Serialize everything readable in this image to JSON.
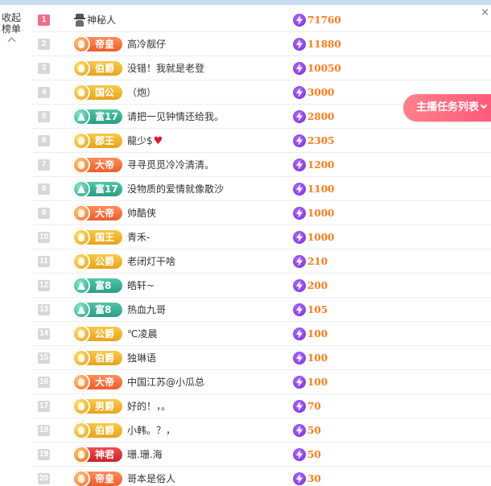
{
  "collapse": {
    "label": "收起榜单"
  },
  "close_glyph": "×",
  "task_button": {
    "label": "主播任务列表"
  },
  "rows": [
    {
      "rank": "1",
      "badge": null,
      "badge_style": "mystery",
      "name": "神秘人",
      "score": "71760"
    },
    {
      "rank": "2",
      "badge": "帝皇",
      "badge_style": "orange",
      "name": "高冷靓仔",
      "score": "11880"
    },
    {
      "rank": "3",
      "badge": "伯爵",
      "badge_style": "gold",
      "name": "没错！我就是老登",
      "score": "10050"
    },
    {
      "rank": "4",
      "badge": "国公",
      "badge_style": "gold",
      "name": "（炮）",
      "score": "3000"
    },
    {
      "rank": "5",
      "badge": "富17",
      "badge_style": "teal",
      "name": "请把一见钟情还给我。",
      "score": "2800"
    },
    {
      "rank": "6",
      "badge": "郡王",
      "badge_style": "gold",
      "name": "龍少$",
      "score": "2305",
      "heart": true
    },
    {
      "rank": "7",
      "badge": "大帝",
      "badge_style": "orange",
      "name": "寻寻觅觅冷冷清清。",
      "score": "1200"
    },
    {
      "rank": "8",
      "badge": "富17",
      "badge_style": "teal",
      "name": "没物质的爱情就像散沙",
      "score": "1100"
    },
    {
      "rank": "9",
      "badge": "大帝",
      "badge_style": "orange",
      "name": "帅酷侠",
      "score": "1000"
    },
    {
      "rank": "10",
      "badge": "国王",
      "badge_style": "gold",
      "name": "青禾-",
      "score": "1000"
    },
    {
      "rank": "11",
      "badge": "公爵",
      "badge_style": "gold",
      "name": "老闭灯干啥",
      "score": "210"
    },
    {
      "rank": "12",
      "badge": "富8",
      "badge_style": "teal",
      "name": "皓轩~",
      "score": "200"
    },
    {
      "rank": "13",
      "badge": "富8",
      "badge_style": "teal",
      "name": "热血九哥",
      "score": "105"
    },
    {
      "rank": "14",
      "badge": "公爵",
      "badge_style": "gold",
      "name": "℃凌晨",
      "score": "100"
    },
    {
      "rank": "15",
      "badge": "伯爵",
      "badge_style": "gold",
      "name": "独琳语",
      "score": "100"
    },
    {
      "rank": "16",
      "badge": "大帝",
      "badge_style": "orange",
      "name": "中国江苏@小瓜总",
      "score": "100"
    },
    {
      "rank": "17",
      "badge": "男爵",
      "badge_style": "gold",
      "name": "好的！，。",
      "score": "70"
    },
    {
      "rank": "18",
      "badge": "伯爵",
      "badge_style": "gold",
      "name": "小韩。？，",
      "score": "50"
    },
    {
      "rank": "19",
      "badge": "神君",
      "badge_style": "red",
      "name": "珊.珊.海",
      "score": "50"
    },
    {
      "rank": "20",
      "badge": "帝皇",
      "badge_style": "orange",
      "name": "哥本是俗人",
      "score": "30"
    }
  ]
}
